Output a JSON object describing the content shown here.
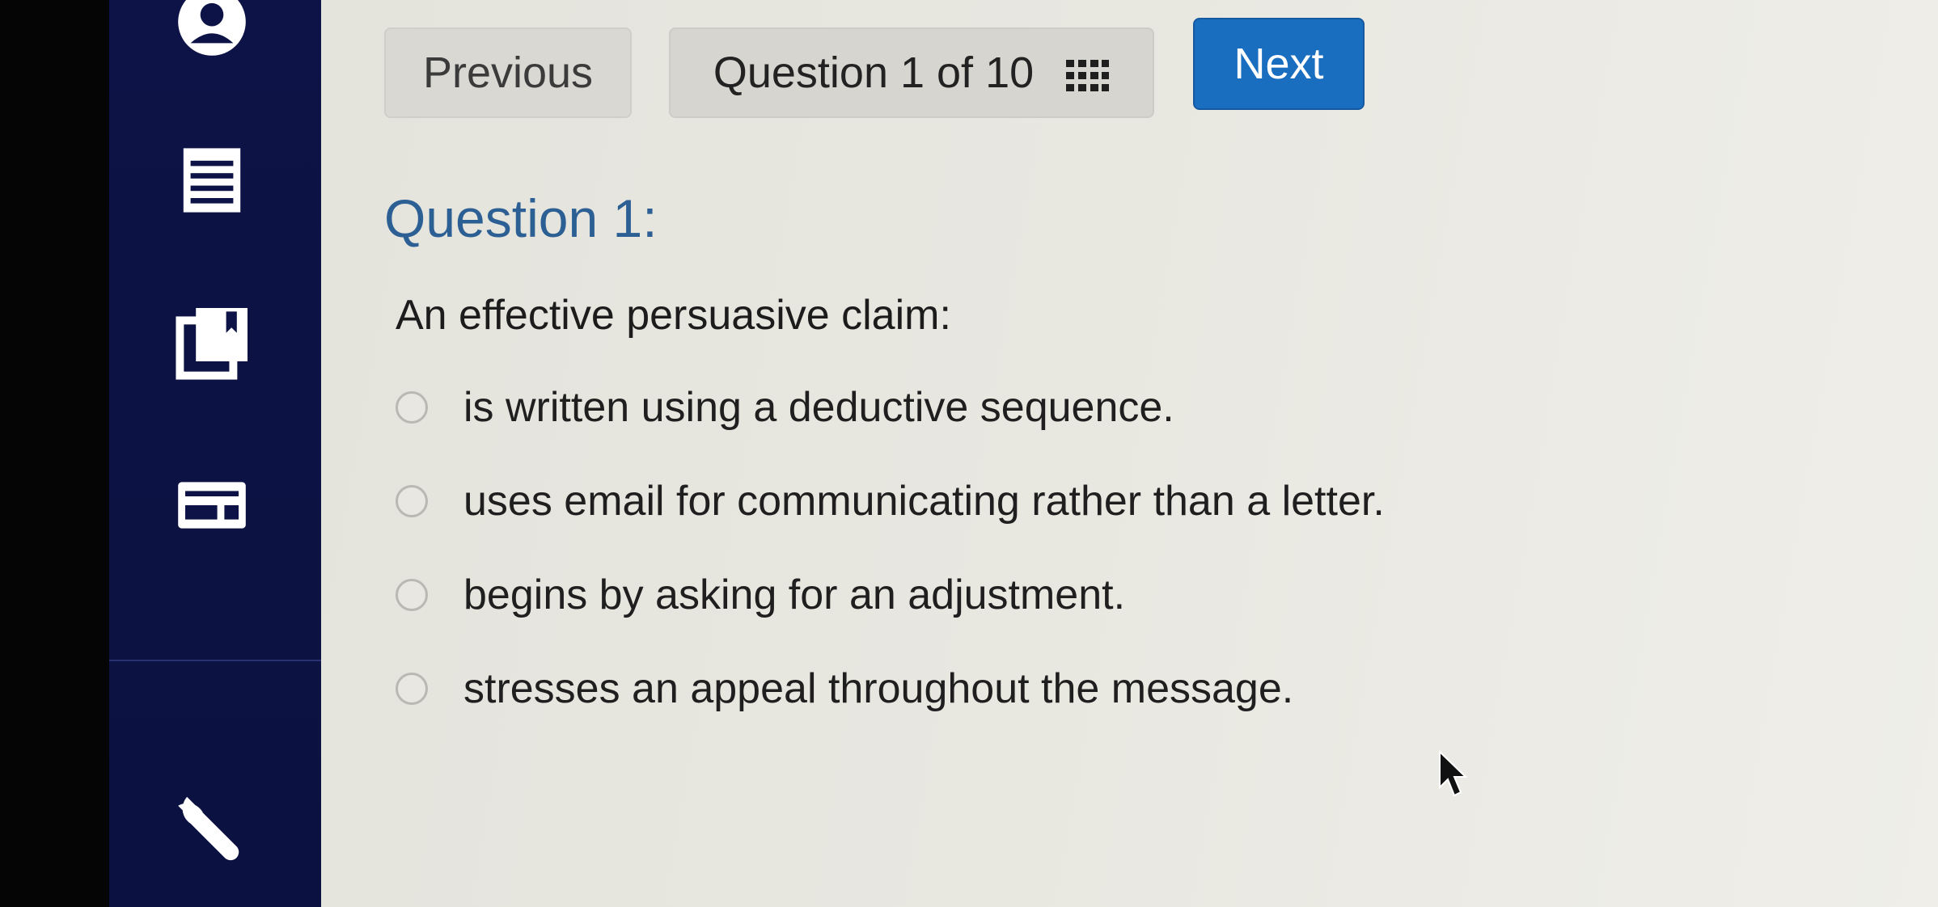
{
  "toolbar": {
    "previous_label": "Previous",
    "question_counter": "Question 1 of 10",
    "next_label": "Next"
  },
  "question": {
    "title": "Question 1:",
    "stem": "An effective persuasive claim:",
    "choices": [
      "is written using a deductive sequence.",
      "uses email for communicating rather than a letter.",
      "begins by asking for an adjustment.",
      "stresses an appeal throughout the message."
    ]
  },
  "sidebar": {
    "icons": [
      "user-icon",
      "notes-icon",
      "bookmarks-icon",
      "card-icon",
      "wrench-icon"
    ]
  },
  "colors": {
    "sidebar": "#0d1346",
    "next_button": "#1a6ec0",
    "question_title": "#2c5f93",
    "page_background": "#e8e7e0"
  }
}
